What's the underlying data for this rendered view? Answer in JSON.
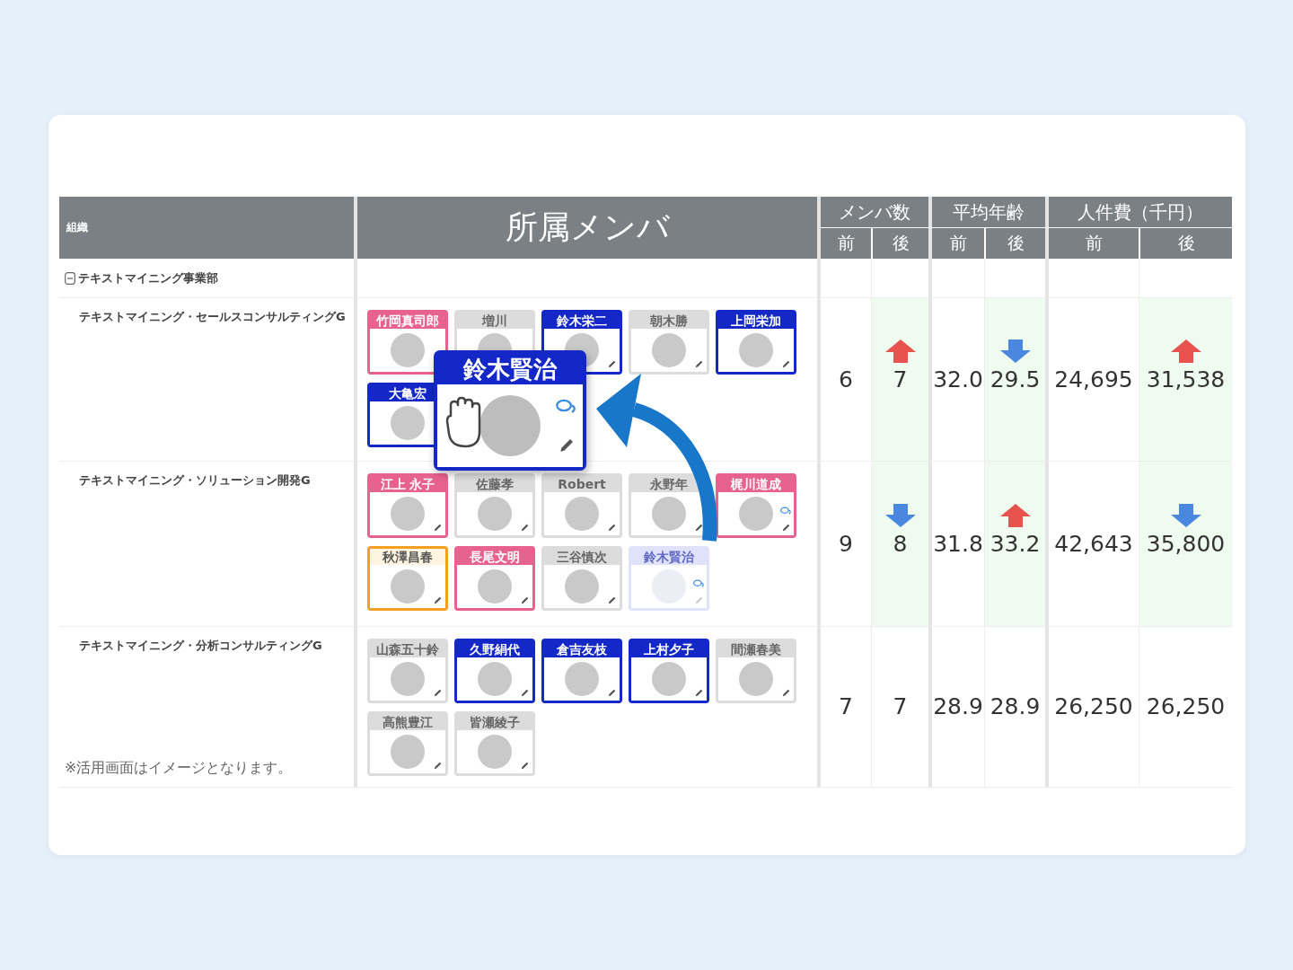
{
  "table": {
    "headers": {
      "organization": "組織",
      "members": "所属メンバ",
      "groups": [
        {
          "label": "メンバ数",
          "before": "前",
          "after": "後"
        },
        {
          "label": "平均年齢",
          "before": "前",
          "after": "後"
        },
        {
          "label": "人件費（千円）",
          "before": "前",
          "after": "後"
        }
      ]
    },
    "department": {
      "name": "テキストマイニング事業部",
      "expanded": true
    },
    "rows": [
      {
        "group": "テキストマイニング・セールスコンサルティングG",
        "members": [
          {
            "name": "竹岡真司郎",
            "kind": "filled",
            "color": "#e8628f",
            "chat": false
          },
          {
            "name": "増川",
            "kind": "filled",
            "color": "#dcdcdc",
            "chat": false
          },
          {
            "name": "鈴木栄二",
            "kind": "filled",
            "color": "#1428c8",
            "chat": false
          },
          {
            "name": "朝木勝",
            "kind": "filled",
            "color": "#dcdcdc",
            "chat": false
          },
          {
            "name": "上岡栄加",
            "kind": "filled",
            "color": "#1428c8",
            "chat": false
          },
          {
            "name": "大亀宏",
            "kind": "filled",
            "color": "#1428c8",
            "chat": false
          }
        ],
        "metrics": [
          {
            "before": "6",
            "after": "7",
            "kind": "up"
          },
          {
            "before": "32.0",
            "after": "29.5",
            "kind": "down"
          },
          {
            "before": "24,695",
            "after": "31,538",
            "kind": "up"
          }
        ]
      },
      {
        "group": "テキストマイニング・ソリューション開発G",
        "members": [
          {
            "name": "江上 永子",
            "kind": "filled",
            "color": "#e8628f",
            "chat": false
          },
          {
            "name": "佐藤孝",
            "kind": "filled",
            "color": "#dcdcdc",
            "chat": false
          },
          {
            "name": "Robert",
            "kind": "filled",
            "color": "#dcdcdc",
            "chat": false
          },
          {
            "name": "永野年",
            "kind": "filled",
            "color": "#dcdcdc",
            "chat": false
          },
          {
            "name": "梶川道成",
            "kind": "filled",
            "color": "#e8628f",
            "chat": true
          },
          {
            "name": "秋澤昌春",
            "kind": "outline",
            "color": "#f5a020",
            "chat": false
          },
          {
            "name": "長尾文明",
            "kind": "filled",
            "color": "#e8628f",
            "chat": false
          },
          {
            "name": "三谷慎次",
            "kind": "filled",
            "color": "#dcdcdc",
            "chat": false
          },
          {
            "name": "鈴木賢治",
            "kind": "ghost",
            "color": "#dfe2fa",
            "chat": true
          }
        ],
        "metrics": [
          {
            "before": "9",
            "after": "8",
            "kind": "down"
          },
          {
            "before": "31.8",
            "after": "33.2",
            "kind": "up"
          },
          {
            "before": "42,643",
            "after": "35,800",
            "kind": "down"
          }
        ]
      },
      {
        "group": "テキストマイニング・分析コンサルティングG",
        "members": [
          {
            "name": "山森五十鈴",
            "kind": "filled",
            "color": "#dcdcdc",
            "chat": false
          },
          {
            "name": "久野絹代",
            "kind": "filled",
            "color": "#1428c8",
            "chat": false
          },
          {
            "name": "倉吉友枝",
            "kind": "filled",
            "color": "#1428c8",
            "chat": false
          },
          {
            "name": "上村夕子",
            "kind": "filled",
            "color": "#1428c8",
            "chat": false
          },
          {
            "name": "間瀬春美",
            "kind": "filled",
            "color": "#dcdcdc",
            "chat": false
          },
          {
            "name": "高熊豊江",
            "kind": "filled",
            "color": "#dcdcdc",
            "chat": false
          },
          {
            "name": "皆瀬綾子",
            "kind": "filled",
            "color": "#dcdcdc",
            "chat": false
          }
        ],
        "metrics": [
          {
            "before": "7",
            "after": "7",
            "kind": "flat"
          },
          {
            "before": "28.9",
            "after": "28.9",
            "kind": "flat"
          },
          {
            "before": "26,250",
            "after": "26,250",
            "kind": "flat"
          }
        ]
      }
    ]
  },
  "drag": {
    "name": "鈴木賢治",
    "color": "#1428c8",
    "chat": true
  },
  "footnote": "※活用画面はイメージとなります。"
}
